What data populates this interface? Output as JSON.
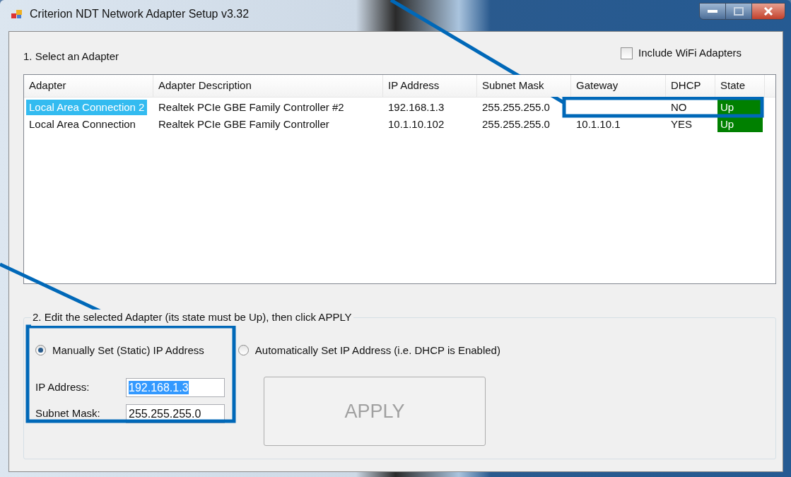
{
  "window": {
    "title": "Criterion NDT Network Adapter Setup v3.32"
  },
  "section_1": {
    "title": "1. Select an Adapter",
    "include_wifi": {
      "label": "Include WiFi Adapters",
      "checked": false
    }
  },
  "table": {
    "columns": [
      "Adapter",
      "Adapter Description",
      "IP Address",
      "Subnet Mask",
      "Gateway",
      "DHCP",
      "State"
    ],
    "rows": [
      {
        "selected": true,
        "cells": [
          "Local Area Connection 2",
          "Realtek PCIe GBE Family Controller #2",
          "192.168.1.3",
          "255.255.255.0",
          "",
          "NO",
          "Up"
        ],
        "color": "#008000"
      },
      {
        "selected": false,
        "cells": [
          "Local Area Connection",
          "Realtek PCIe GBE Family Controller",
          "10.1.10.102",
          "255.255.255.0",
          "10.1.10.1",
          "YES",
          "Up"
        ],
        "color": "#008000"
      }
    ]
  },
  "section_2": {
    "title": "2. Edit the selected Adapter (its state must be Up), then click APPLY",
    "modes": [
      {
        "label": "Manually Set (Static) IP Address",
        "selected": true
      },
      {
        "label": "Automatically Set IP Address (i.e. DHCP is Enabled)",
        "selected": false
      }
    ],
    "fields": [
      {
        "label": "IP Address:",
        "value": "192.168.1.3",
        "text_selected": true
      },
      {
        "label": "Subnet Mask:",
        "value": "255.255.255.0",
        "text_selected": false
      }
    ],
    "apply_button": {
      "label": "APPLY",
      "disabled": true
    }
  }
}
